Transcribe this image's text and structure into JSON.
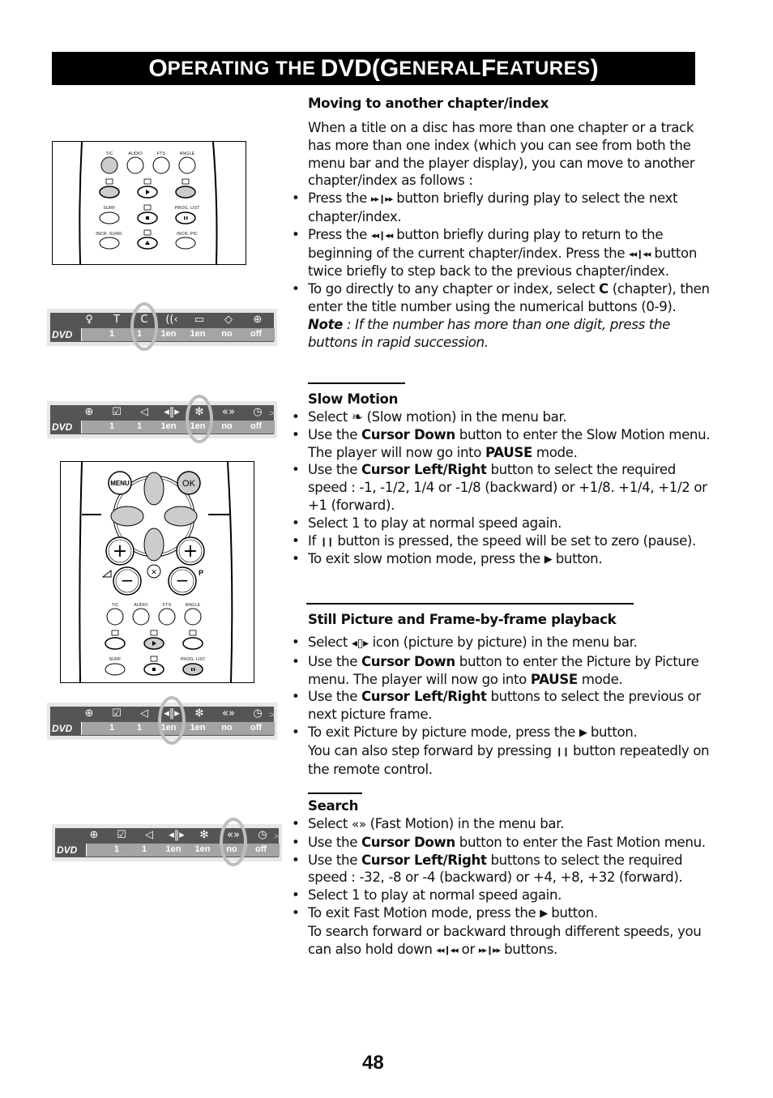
{
  "header": {
    "title_parts": [
      "O",
      "PERATING THE ",
      "DVD",
      " (G",
      "ENERAL ",
      "F",
      "EATURES",
      ")"
    ]
  },
  "remote_small": {
    "labels_row1": [
      "T/C",
      "AUDIO",
      "FTS",
      "ANGLE"
    ],
    "labels_row3": [
      "SURF",
      "PROG. LIST"
    ],
    "labels_row4": [
      "INCR. SURR.",
      "INCR. PIC"
    ]
  },
  "remote_large": {
    "menu_label": "MENU",
    "ok_label": "OK",
    "p_label": "P",
    "labels_row1": [
      "T/C",
      "AUDIO",
      "FTS",
      "ANGLE"
    ],
    "labels_row3": [
      "SURF",
      "PROG. LIST"
    ]
  },
  "menubars": [
    {
      "logo": "DVD",
      "icons": [
        "timer-icon",
        "T",
        "C",
        "audio-icon",
        "subtitle-icon",
        "angle-icon",
        "zoom-icon"
      ],
      "icon_glyphs": [
        "♀",
        "T",
        "C",
        "((‹",
        "▭",
        "◇",
        "⊕"
      ],
      "values": [
        "1",
        "1",
        "1en",
        "1en",
        "no",
        "off"
      ],
      "highlight_index": 2,
      "has_more": false
    },
    {
      "logo": "DVD",
      "icons": [
        "zoom-icon",
        "check-icon",
        "audio-icon",
        "frame-icon",
        "slow-motion-icon",
        "fast-motion-icon",
        "time-search-icon"
      ],
      "icon_glyphs": [
        "⊕",
        "☑",
        "◁",
        "◂‖▸",
        "❇",
        "«»",
        "◷"
      ],
      "values": [
        "1",
        "1",
        "1en",
        "1en",
        "no",
        "off"
      ],
      "highlight_index": 4,
      "has_more": true
    },
    {
      "logo": "DVD",
      "icons": [
        "zoom-icon",
        "check-icon",
        "audio-icon",
        "frame-icon",
        "slow-motion-icon",
        "fast-motion-icon",
        "time-search-icon"
      ],
      "icon_glyphs": [
        "⊕",
        "☑",
        "◁",
        "◂‖▸",
        "❇",
        "«»",
        "◷"
      ],
      "values": [
        "1",
        "1",
        "1en",
        "1en",
        "no",
        "off"
      ],
      "highlight_index": 3,
      "has_more": true
    },
    {
      "logo": "DVD",
      "icons": [
        "zoom-icon",
        "check-icon",
        "audio-icon",
        "frame-icon",
        "slow-motion-icon",
        "fast-motion-icon",
        "time-search-icon"
      ],
      "icon_glyphs": [
        "⊕",
        "☑",
        "◁",
        "◂‖▸",
        "❇",
        "«»",
        "◷"
      ],
      "values": [
        "1",
        "1",
        "1en",
        "1en",
        "no",
        "off"
      ],
      "highlight_index": 5,
      "has_more": true
    }
  ],
  "sections": {
    "chapter": {
      "heading": "Moving to another chapter/index",
      "intro": "When a title on a disc has more than one chapter or a track has more than one index (which you can see from both the menu bar and the player display), you can move to another chapter/index as follows :",
      "b1_pre": "Press the ",
      "b1_glyph": "▸▸❙▸▸",
      "b1_post": " button briefly during play to select the next chapter/index.",
      "b2_pre": "Press the ",
      "b2_glyph": "◂◂❙◂◂",
      "b2_mid": " button briefly during play to return to the beginning of the current chapter/index. Press the ",
      "b2_glyph2": "◂◂❙◂◂",
      "b2_post": " button twice briefly to step back to the previous chapter/index.",
      "b3_pre": "To go directly to any chapter or index, select ",
      "b3_bold": "C",
      "b3_mid": " (chapter), then enter the title number using the numerical buttons (0-9).   ",
      "b3_note": "Note",
      "b3_italic": " : If the number has more than one digit, press the buttons in rapid succession."
    },
    "slow": {
      "heading": "Slow Motion",
      "b1_pre": "Select ",
      "b1_post": " (Slow motion) in the menu bar.",
      "b2_pre": "Use the ",
      "b2_bold": "Cursor Down",
      "b2_mid": " button to enter the Slow Motion menu. The player will now go into ",
      "b2_bold2": "PAUSE",
      "b2_post": " mode.",
      "b3_pre": "Use the ",
      "b3_bold": "Cursor Left/Right",
      "b3_post": " button to select the required speed : -1, -1/2, 1/4 or -1/8 (backward) or +1/8. +1/4,  +1/2 or +1 (forward).",
      "b4": "Select 1 to play at normal speed again.",
      "b5_pre": "If ",
      "b5_glyph": "❙❙",
      "b5_post": " button is pressed, the speed will be set to zero (pause).",
      "b6_pre": "To exit slow motion mode, press the ",
      "b6_glyph": "▶",
      "b6_post": " button."
    },
    "still": {
      "heading": "Still Picture and Frame-by-frame playback",
      "b1_pre": "Select ",
      "b1_post": "  icon (picture by picture) in the menu bar.",
      "b2_pre": "Use the ",
      "b2_bold": "Cursor Down",
      "b2_mid": " button to enter the Picture by Picture menu.  The player will now go into ",
      "b2_bold2": "PAUSE",
      "b2_post": " mode.",
      "b3_pre": "Use the ",
      "b3_bold": "Cursor Left/Right",
      "b3_post": " buttons to select the previous or next picture frame.",
      "b4_pre": "To exit Picture by picture mode, press the ",
      "b4_glyph": "▶",
      "b4_mid": " button.",
      "b4_line2_pre": " You can also step forward by pressing ",
      "b4_glyph2": "❙❙",
      "b4_post": " button repeatedly on the remote control."
    },
    "search": {
      "heading": "Search",
      "b1_pre": "Select ",
      "b1_post": " (Fast Motion) in the menu bar.",
      "b2_pre": "Use the ",
      "b2_bold": "Cursor Down",
      "b2_post": " button to enter the Fast Motion menu.",
      "b3_pre": "Use the ",
      "b3_bold": "Cursor Left/Right",
      "b3_post": " buttons to select the required speed : -32, -8 or -4 (backward) or +4, +8, +32 (forward).",
      "b4": "Select 1 to play at normal speed again.",
      "b5_pre": "To exit Fast Motion mode, press the  ",
      "b5_glyph": "▶",
      "b5_mid": " button.",
      "b5_line2_pre": "To search forward or backward through different speeds, you can also hold down ",
      "b5_glyph2": "◂◂❙◂◂",
      "b5_or": "   or ",
      "b5_glyph3": "▸▸❙▸▸",
      "b5_post": " buttons."
    }
  },
  "page_number": "48"
}
